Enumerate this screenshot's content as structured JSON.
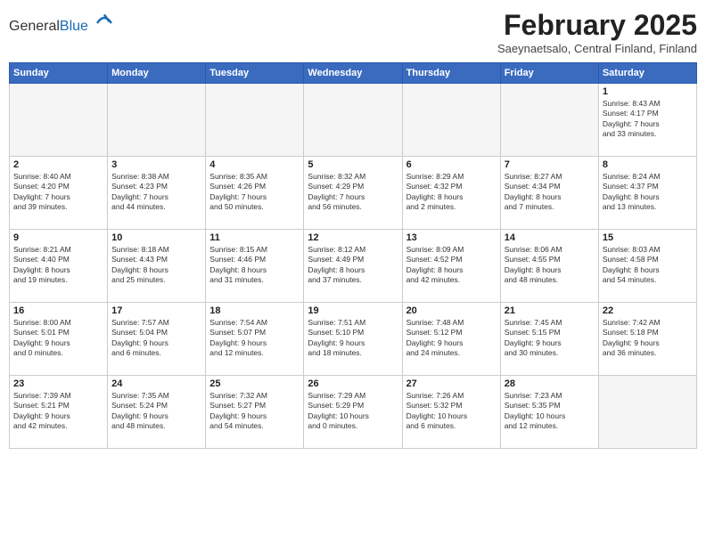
{
  "header": {
    "logo": {
      "general": "General",
      "blue": "Blue"
    },
    "title": "February 2025",
    "subtitle": "Saeynaetsalo, Central Finland, Finland"
  },
  "weekdays": [
    "Sunday",
    "Monday",
    "Tuesday",
    "Wednesday",
    "Thursday",
    "Friday",
    "Saturday"
  ],
  "weeks": [
    [
      {
        "day": "",
        "empty": true
      },
      {
        "day": "",
        "empty": true
      },
      {
        "day": "",
        "empty": true
      },
      {
        "day": "",
        "empty": true
      },
      {
        "day": "",
        "empty": true
      },
      {
        "day": "",
        "empty": true
      },
      {
        "day": "1",
        "info": "Sunrise: 8:43 AM\nSunset: 4:17 PM\nDaylight: 7 hours\nand 33 minutes."
      }
    ],
    [
      {
        "day": "2",
        "info": "Sunrise: 8:40 AM\nSunset: 4:20 PM\nDaylight: 7 hours\nand 39 minutes."
      },
      {
        "day": "3",
        "info": "Sunrise: 8:38 AM\nSunset: 4:23 PM\nDaylight: 7 hours\nand 44 minutes."
      },
      {
        "day": "4",
        "info": "Sunrise: 8:35 AM\nSunset: 4:26 PM\nDaylight: 7 hours\nand 50 minutes."
      },
      {
        "day": "5",
        "info": "Sunrise: 8:32 AM\nSunset: 4:29 PM\nDaylight: 7 hours\nand 56 minutes."
      },
      {
        "day": "6",
        "info": "Sunrise: 8:29 AM\nSunset: 4:32 PM\nDaylight: 8 hours\nand 2 minutes."
      },
      {
        "day": "7",
        "info": "Sunrise: 8:27 AM\nSunset: 4:34 PM\nDaylight: 8 hours\nand 7 minutes."
      },
      {
        "day": "8",
        "info": "Sunrise: 8:24 AM\nSunset: 4:37 PM\nDaylight: 8 hours\nand 13 minutes."
      }
    ],
    [
      {
        "day": "9",
        "info": "Sunrise: 8:21 AM\nSunset: 4:40 PM\nDaylight: 8 hours\nand 19 minutes."
      },
      {
        "day": "10",
        "info": "Sunrise: 8:18 AM\nSunset: 4:43 PM\nDaylight: 8 hours\nand 25 minutes."
      },
      {
        "day": "11",
        "info": "Sunrise: 8:15 AM\nSunset: 4:46 PM\nDaylight: 8 hours\nand 31 minutes."
      },
      {
        "day": "12",
        "info": "Sunrise: 8:12 AM\nSunset: 4:49 PM\nDaylight: 8 hours\nand 37 minutes."
      },
      {
        "day": "13",
        "info": "Sunrise: 8:09 AM\nSunset: 4:52 PM\nDaylight: 8 hours\nand 42 minutes."
      },
      {
        "day": "14",
        "info": "Sunrise: 8:06 AM\nSunset: 4:55 PM\nDaylight: 8 hours\nand 48 minutes."
      },
      {
        "day": "15",
        "info": "Sunrise: 8:03 AM\nSunset: 4:58 PM\nDaylight: 8 hours\nand 54 minutes."
      }
    ],
    [
      {
        "day": "16",
        "info": "Sunrise: 8:00 AM\nSunset: 5:01 PM\nDaylight: 9 hours\nand 0 minutes."
      },
      {
        "day": "17",
        "info": "Sunrise: 7:57 AM\nSunset: 5:04 PM\nDaylight: 9 hours\nand 6 minutes."
      },
      {
        "day": "18",
        "info": "Sunrise: 7:54 AM\nSunset: 5:07 PM\nDaylight: 9 hours\nand 12 minutes."
      },
      {
        "day": "19",
        "info": "Sunrise: 7:51 AM\nSunset: 5:10 PM\nDaylight: 9 hours\nand 18 minutes."
      },
      {
        "day": "20",
        "info": "Sunrise: 7:48 AM\nSunset: 5:12 PM\nDaylight: 9 hours\nand 24 minutes."
      },
      {
        "day": "21",
        "info": "Sunrise: 7:45 AM\nSunset: 5:15 PM\nDaylight: 9 hours\nand 30 minutes."
      },
      {
        "day": "22",
        "info": "Sunrise: 7:42 AM\nSunset: 5:18 PM\nDaylight: 9 hours\nand 36 minutes."
      }
    ],
    [
      {
        "day": "23",
        "info": "Sunrise: 7:39 AM\nSunset: 5:21 PM\nDaylight: 9 hours\nand 42 minutes."
      },
      {
        "day": "24",
        "info": "Sunrise: 7:35 AM\nSunset: 5:24 PM\nDaylight: 9 hours\nand 48 minutes."
      },
      {
        "day": "25",
        "info": "Sunrise: 7:32 AM\nSunset: 5:27 PM\nDaylight: 9 hours\nand 54 minutes."
      },
      {
        "day": "26",
        "info": "Sunrise: 7:29 AM\nSunset: 5:29 PM\nDaylight: 10 hours\nand 0 minutes."
      },
      {
        "day": "27",
        "info": "Sunrise: 7:26 AM\nSunset: 5:32 PM\nDaylight: 10 hours\nand 6 minutes."
      },
      {
        "day": "28",
        "info": "Sunrise: 7:23 AM\nSunset: 5:35 PM\nDaylight: 10 hours\nand 12 minutes."
      },
      {
        "day": "",
        "empty": true
      }
    ]
  ]
}
